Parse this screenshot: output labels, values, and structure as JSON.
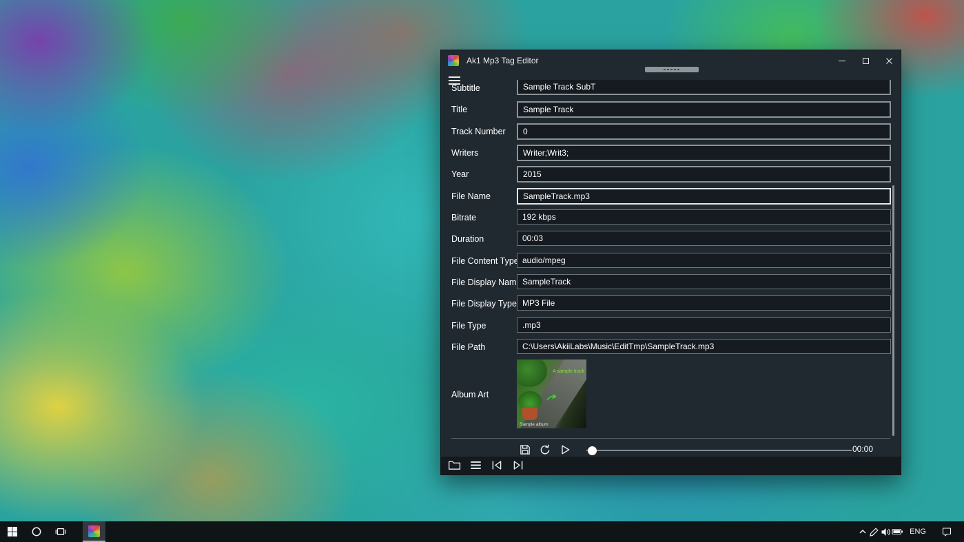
{
  "window": {
    "title": "Ak1 Mp3 Tag Editor"
  },
  "fields": [
    {
      "label": "Subtitle",
      "value": "Sample Track SubT",
      "state": "editable clipped"
    },
    {
      "label": "Title",
      "value": "Sample Track",
      "state": "editable"
    },
    {
      "label": "Track Number",
      "value": "0",
      "state": "editable"
    },
    {
      "label": "Writers",
      "value": "Writer;Writ3;",
      "state": "editable"
    },
    {
      "label": "Year",
      "value": "2015",
      "state": "editable"
    },
    {
      "label": "File Name",
      "value": "SampleTrack.mp3",
      "state": "editable focused"
    },
    {
      "label": "Bitrate",
      "value": "192 kbps",
      "state": "readonly"
    },
    {
      "label": "Duration",
      "value": "00:03",
      "state": "readonly"
    },
    {
      "label": "File Content Type",
      "value": "audio/mpeg",
      "state": "readonly"
    },
    {
      "label": "File Display Name",
      "value": "SampleTrack",
      "state": "readonly"
    },
    {
      "label": "File Display Type",
      "value": "MP3 File",
      "state": "readonly"
    },
    {
      "label": "File Type",
      "value": ".mp3",
      "state": "readonly"
    },
    {
      "label": "File Path",
      "value": "C:\\Users\\AkiiLabs\\Music\\EditTmp\\SampleTrack.mp3",
      "state": "readonly"
    }
  ],
  "album_art": {
    "label": "Album Art",
    "caption_top": "A sample track",
    "caption_bottom": "Sample album"
  },
  "player": {
    "elapsed": "00:00"
  },
  "taskbar": {
    "language": "ENG"
  }
}
